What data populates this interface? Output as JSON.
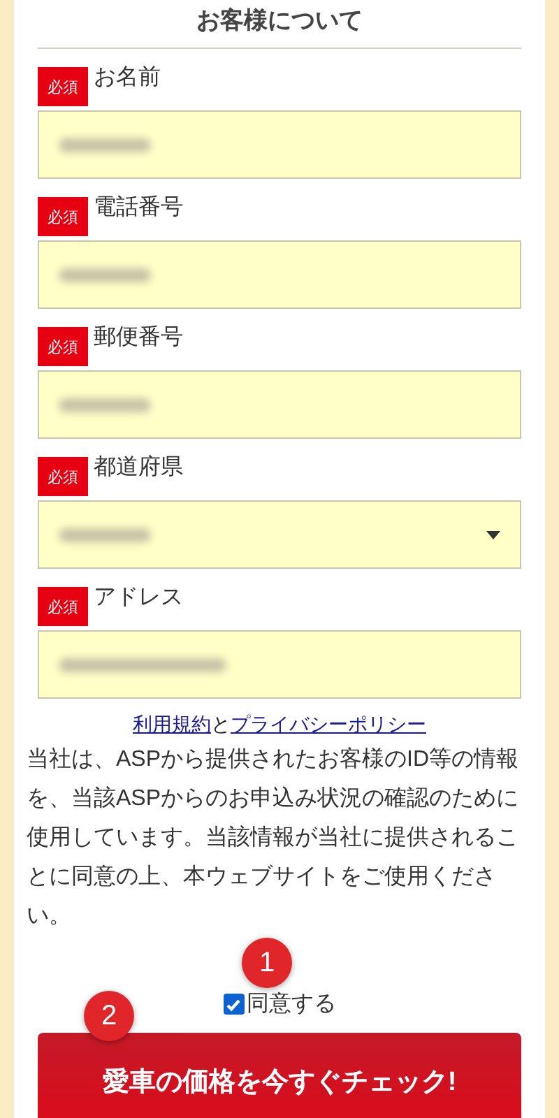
{
  "section_title": "お客様について",
  "fields": [
    {
      "kind": "text",
      "badge": "必須",
      "label": "お名前"
    },
    {
      "kind": "text",
      "badge": "必須",
      "label": "電話番号"
    },
    {
      "kind": "text",
      "badge": "必須",
      "label": "郵便番号"
    },
    {
      "kind": "select",
      "badge": "必須",
      "label": "都道府県"
    },
    {
      "kind": "text",
      "badge": "必須",
      "label": "アドレス"
    }
  ],
  "links": {
    "terms": "利用規約",
    "joiner": "と",
    "privacy": "プライバシーポリシー"
  },
  "notice": "当社は、ASPから提供されたお客様のID等の情報を、当該ASPからのお申込み状況の確認のために使用しています。当該情報が当社に提供されることに同意の上、本ウェブサイトをご使用ください。",
  "agree": {
    "label": "同意する",
    "checked": true
  },
  "submit": "愛車の価格を今すぐチェック!",
  "callouts": [
    "1",
    "2"
  ]
}
